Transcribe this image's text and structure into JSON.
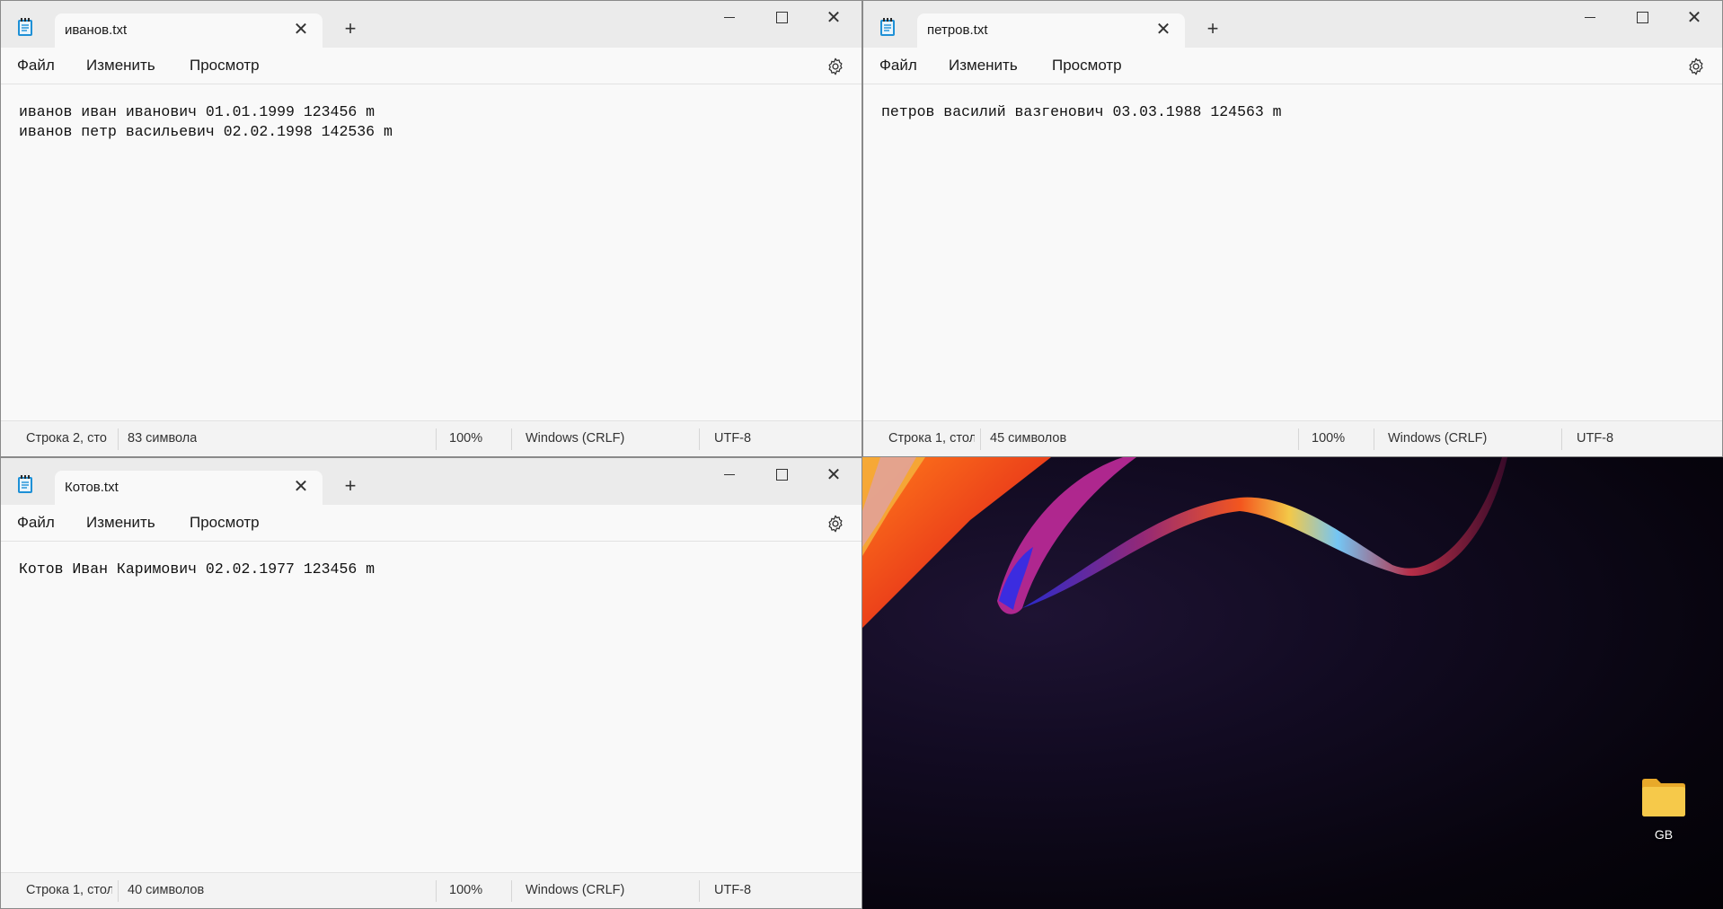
{
  "colors": {
    "accent": "#1e90d6",
    "folder": "#f6c94a"
  },
  "windows": [
    {
      "file_name": "иванов.txt",
      "menu": {
        "file": "Файл",
        "edit": "Изменить",
        "view": "Просмотр"
      },
      "lines": [
        "иванов иван иванович 01.01.1999 123456 m",
        "иванов петр васильевич 02.02.1998 142536 m"
      ],
      "status": {
        "position": "Строка 2, сто",
        "chars": "83 символа",
        "zoom": "100%",
        "line_ending": "Windows (CRLF)",
        "encoding": "UTF-8"
      }
    },
    {
      "file_name": "петров.txt",
      "menu": {
        "file": "Файл",
        "edit": "Изменить",
        "view": "Просмотр"
      },
      "lines": [
        "петров василий вазгенович 03.03.1988 124563 m"
      ],
      "status": {
        "position": "Строка 1, стол",
        "chars": "45 символов",
        "zoom": "100%",
        "line_ending": "Windows (CRLF)",
        "encoding": "UTF-8"
      }
    },
    {
      "file_name": "Котов.txt",
      "menu": {
        "file": "Файл",
        "edit": "Изменить",
        "view": "Просмотр"
      },
      "lines": [
        "Котов Иван Каримович 02.02.1977 123456 m"
      ],
      "status": {
        "position": "Строка 1, стол",
        "chars": "40 символов",
        "zoom": "100%",
        "line_ending": "Windows (CRLF)",
        "encoding": "UTF-8"
      }
    }
  ],
  "desktop": {
    "icons": [
      {
        "label": "GB",
        "icon": "folder-icon"
      }
    ]
  },
  "icons": {
    "app": "notepad-icon",
    "tab_close": "close-icon",
    "new_tab": "plus-icon",
    "minimize": "minimize-icon",
    "maximize": "maximize-icon",
    "close": "close-icon",
    "settings": "gear-icon"
  }
}
